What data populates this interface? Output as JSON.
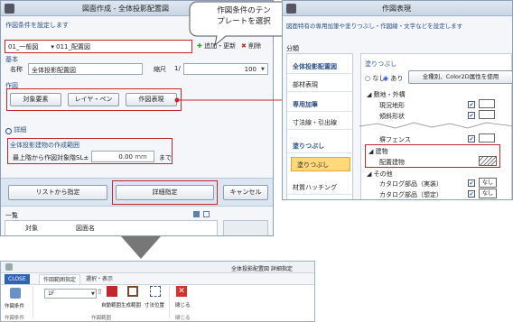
{
  "left_dialog": {
    "title": "図面作成 - 全体投影配置図",
    "template_label": "作図条件を設定します",
    "template_value": "01_一般図　　▾ 011_配置図",
    "add_update": "追加・更新",
    "delete": "削除",
    "basic_label": "基本",
    "name_label": "名称",
    "name_value": "全体投影配置図",
    "scale_label": "縮尺",
    "scale_prefix": "1/",
    "scale_value": "100",
    "drawing_label": "作図",
    "buttons": [
      "対象要素",
      "レイヤ・ペン",
      "作図表現"
    ],
    "detail_label": "詳細",
    "projection_group": "全体投影建物の作成範囲",
    "range_label": "最上階から作図対象階SL±",
    "range_value": "0.00",
    "range_unit": "mm",
    "range_suffix": "まで",
    "bottom_buttons": [
      "リストから指定",
      "詳細指定",
      "キャンセル"
    ],
    "list_label": "一覧",
    "list_columns": [
      "対象",
      "図面名"
    ]
  },
  "callout": {
    "text_line1": "作図条件のテン",
    "text_line2": "プレートを選択"
  },
  "right_dialog": {
    "title": "作図表現",
    "subtitle": "図面特有の専用加筆や塗りつぶし・作図線・文字などを設定します",
    "section": "分類",
    "nav": [
      {
        "label": "全体投影配置図",
        "kind": "acc"
      },
      {
        "label": "部材表現",
        "kind": "item"
      },
      {
        "label": "専用加筆",
        "kind": "acc"
      },
      {
        "label": "寸法線・引出線",
        "kind": "item"
      },
      {
        "label": "塗りつぶし",
        "kind": "acc"
      },
      {
        "label": "塗りつぶし",
        "kind": "sel"
      },
      {
        "label": "材質ハッチング",
        "kind": "item"
      }
    ],
    "fill_label": "塗りつぶし",
    "radio_none": "なし",
    "radio_yes": "あり",
    "color_button": "全種別、Color2D属性を使用",
    "tree": [
      "敷地・外構",
      "現況地形",
      "傾斜形状",
      "塀フェンス",
      "建物",
      "配置建物",
      "その他",
      "カタログ部品（実装）",
      "カタログ部品（想定）"
    ],
    "none_label": "なし"
  },
  "ribbon": {
    "window_title": "全体投影配置図 詳細指定",
    "tabs": [
      "CLOSE",
      "作図範囲指定",
      "選択・表示"
    ],
    "floor_value": "1F",
    "buttons": [
      "作図条件",
      "自動範囲",
      "生成範囲",
      "寸法位置",
      "閉じる"
    ],
    "groups": [
      "作図条件",
      "作図範囲",
      "閉じる"
    ]
  }
}
